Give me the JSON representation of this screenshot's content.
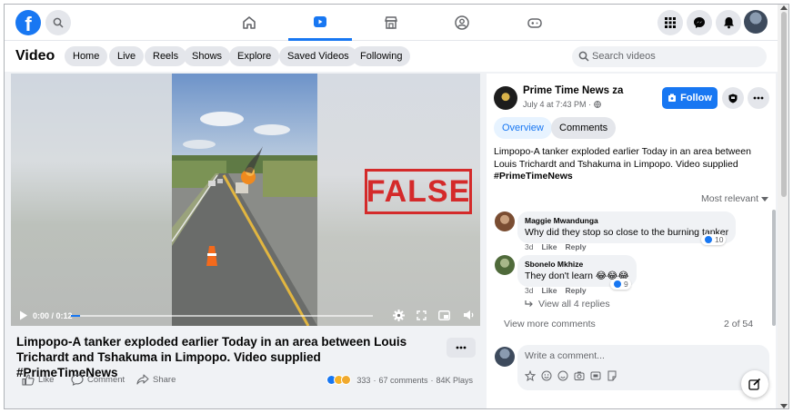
{
  "header": {
    "logo": "f",
    "nav_tabs": [
      {
        "name": "home-icon",
        "active": false
      },
      {
        "name": "video-icon",
        "active": true
      },
      {
        "name": "marketplace-icon",
        "active": false
      },
      {
        "name": "groups-icon",
        "active": false
      },
      {
        "name": "gaming-icon",
        "active": false
      }
    ],
    "right_icons": [
      "menu-grid-icon",
      "messenger-icon",
      "bell-icon",
      "profile-avatar"
    ]
  },
  "video_nav": {
    "title": "Video",
    "tabs": [
      "Home",
      "Live",
      "Reels",
      "Shows",
      "Explore",
      "Saved Videos",
      "Following"
    ],
    "search_placeholder": "Search videos"
  },
  "player": {
    "stamp": "FALSE",
    "time": "0:00 / 0:12",
    "progress": 0.03
  },
  "post": {
    "caption": "Limpopo-A tanker exploded earlier Today in an area between Louis Trichardt and Tshakuma in Limpopo. Video supplied #PrimeTimeNews",
    "actions": {
      "like": "Like",
      "comment": "Comment",
      "share": "Share"
    },
    "reaction_count": "333",
    "comments_count": "67 comments",
    "plays": "84K Plays"
  },
  "panel": {
    "page_name": "Prime Time News za",
    "date": "July 4 at 7:43 PM",
    "date_sep": "·",
    "follow": "Follow",
    "tabs": [
      "Overview",
      "Comments"
    ],
    "description": "Limpopo-A tanker exploded earlier Today in an area between Louis Trichardt and Tshakuma in Limpopo. Video supplied ",
    "hashtag": "#PrimeTimeNews",
    "sort": "Most relevant",
    "comments": [
      {
        "author": "Maggie Mwandunga",
        "text": "Why did they stop so close to the burning tanker",
        "age": "3d",
        "like": "Like",
        "reply": "Reply",
        "likes": "10"
      },
      {
        "author": "Sbonelo Mkhize",
        "text": "They don't learn 😂😂😂",
        "age": "3d",
        "like": "Like",
        "reply": "Reply",
        "likes": "9"
      }
    ],
    "view_replies": "View all 4 replies",
    "view_more": "View more comments",
    "count": "2 of 54",
    "composer_placeholder": "Write a comment..."
  },
  "colors": {
    "brand": "#1877f2",
    "stamp": "#d42a2a"
  }
}
